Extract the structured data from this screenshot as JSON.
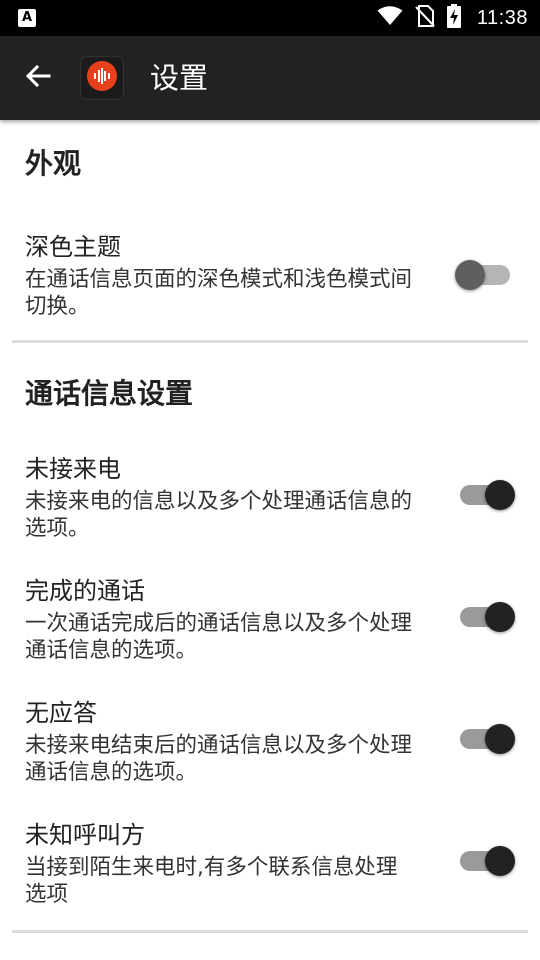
{
  "status_bar": {
    "notification_icon": "A",
    "time": "11:38",
    "icons": [
      "wifi-icon",
      "no-sim-icon",
      "battery-charging-icon"
    ]
  },
  "app_bar": {
    "title": "设置",
    "back_icon": "arrow-left-icon",
    "app_icon": "voice-wave-icon"
  },
  "appearance": {
    "header": "外观",
    "dark_theme": {
      "title": "深色主题",
      "summary": "在通话信息页面的深色模式和浅色模式间切换。",
      "enabled": false
    }
  },
  "call_info": {
    "header": "通话信息设置",
    "items": [
      {
        "title": "未接来电",
        "summary": "未接来电的信息以及多个处理通话信息的选项。",
        "enabled": true
      },
      {
        "title": "完成的通话",
        "summary": "一次通话完成后的通话信息以及多个处理通话信息的选项。",
        "enabled": true
      },
      {
        "title": "无应答",
        "summary": "未接来电结束后的通话信息以及多个处理通话信息的选项。",
        "enabled": true
      },
      {
        "title": "未知呼叫方",
        "summary": "当接到陌生来电时,有多个联系信息处理选项",
        "enabled": true
      }
    ]
  },
  "colors": {
    "app_bar": "#222222",
    "status_bar": "#000000",
    "app_icon_accent": "#e8401c"
  }
}
